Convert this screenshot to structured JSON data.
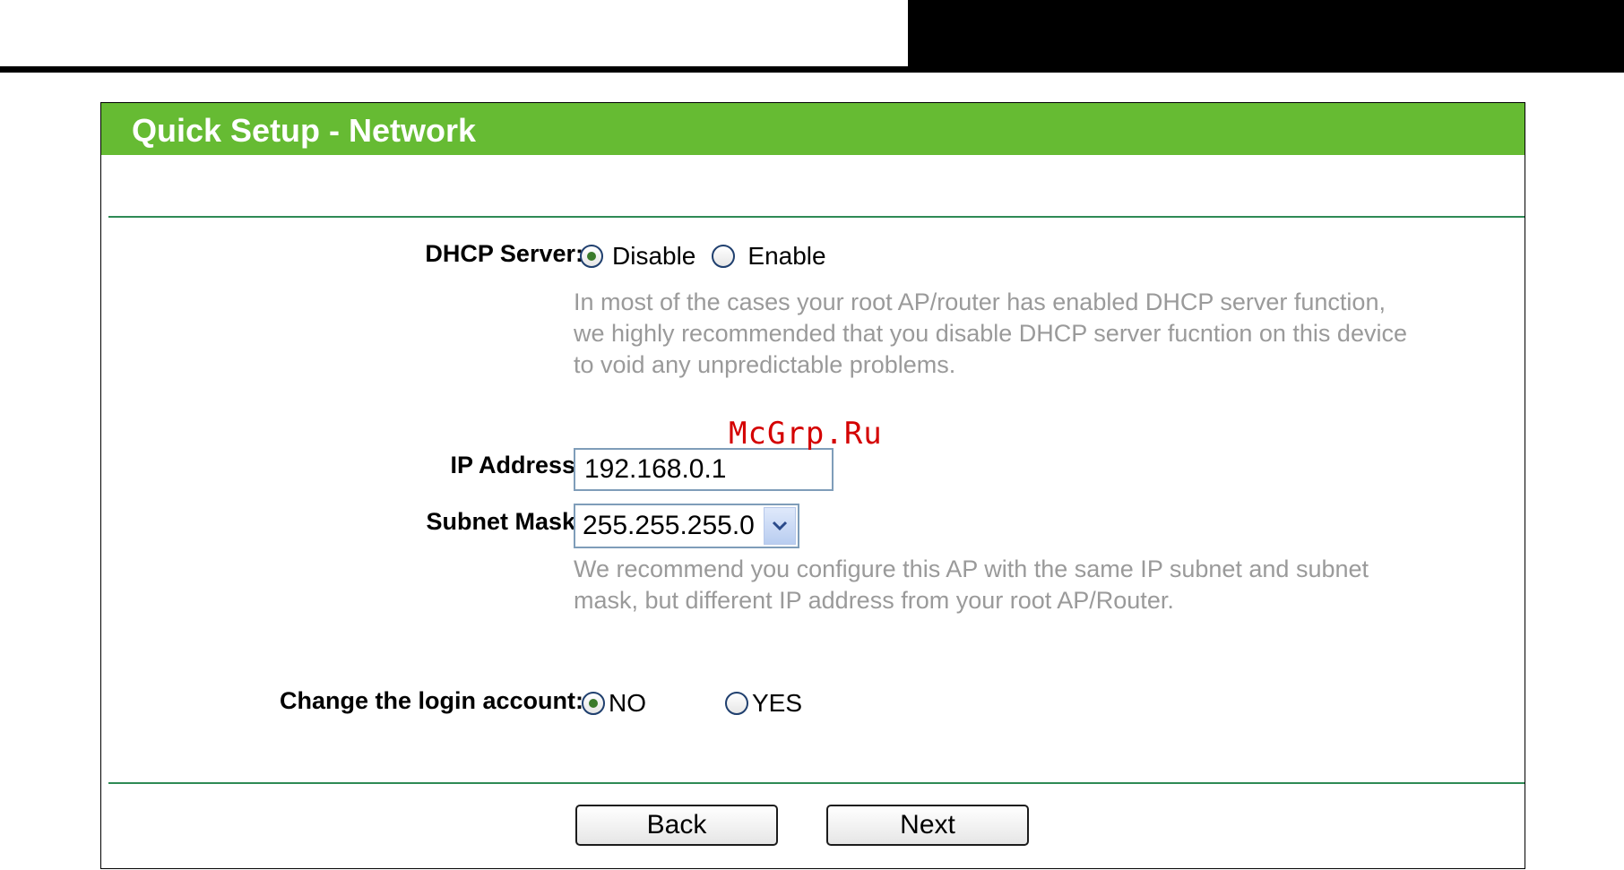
{
  "panel": {
    "title": "Quick Setup - Network"
  },
  "dhcp": {
    "label": "DHCP Server:",
    "options": [
      {
        "label": "Disable",
        "checked": true
      },
      {
        "label": "Enable",
        "checked": false
      }
    ],
    "hint": "In most of the cases your root AP/router has enabled DHCP server function,\nwe highly recommended that you disable DHCP server fucntion on this device\nto void any unpredictable problems."
  },
  "ip": {
    "label": "IP Address:",
    "value": "192.168.0.1"
  },
  "subnet": {
    "label": "Subnet Mask:",
    "selected": "255.255.255.0",
    "hint": "We recommend you configure this AP with the same IP subnet and subnet\nmask, but different IP address from your root AP/Router."
  },
  "login": {
    "label": "Change the login account:",
    "options": [
      {
        "label": "NO",
        "checked": true
      },
      {
        "label": "YES",
        "checked": false
      }
    ]
  },
  "buttons": {
    "back": "Back",
    "next": "Next"
  },
  "watermark": "McGrp.Ru",
  "colors": {
    "header": "#66bb33",
    "divider": "#2f8a55",
    "hint": "#9a9a9a",
    "watermark": "#d40000"
  }
}
